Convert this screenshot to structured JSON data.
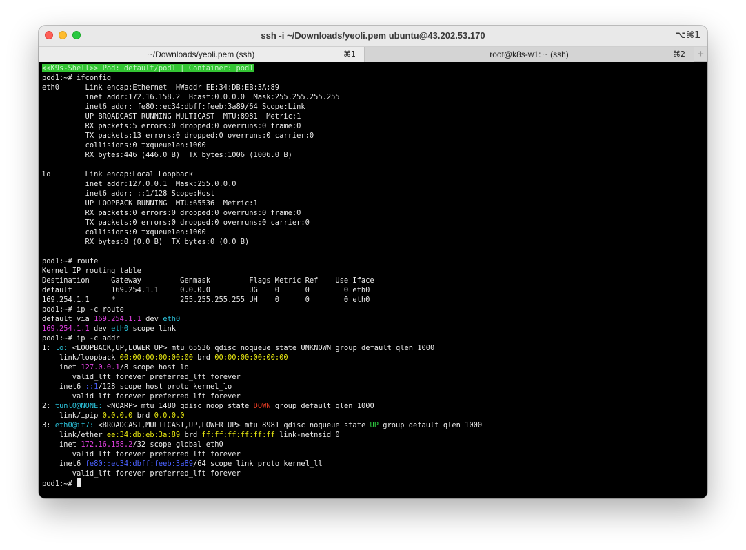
{
  "window": {
    "title": "ssh -i ~/Downloads/yeoli.pem ubuntu@43.202.53.170",
    "shortcut": "⌥⌘1"
  },
  "tabs": [
    {
      "label": "~/Downloads/yeoli.pem (ssh)",
      "shortcut": "⌘1"
    },
    {
      "label": "root@k8s-w1: ~ (ssh)",
      "shortcut": "⌘2"
    }
  ],
  "new_tab_label": "+",
  "terminal": {
    "banner": "<<K9s-Shell>> Pod: default/pod1 | Container: pod1",
    "lines": [
      "pod1:~# ifconfig",
      "eth0      Link encap:Ethernet  HWaddr EE:34:DB:EB:3A:89",
      "          inet addr:172.16.158.2  Bcast:0.0.0.0  Mask:255.255.255.255",
      "          inet6 addr: fe80::ec34:dbff:feeb:3a89/64 Scope:Link",
      "          UP BROADCAST RUNNING MULTICAST  MTU:8981  Metric:1",
      "          RX packets:5 errors:0 dropped:0 overruns:0 frame:0",
      "          TX packets:13 errors:0 dropped:0 overruns:0 carrier:0",
      "          collisions:0 txqueuelen:1000",
      "          RX bytes:446 (446.0 B)  TX bytes:1006 (1006.0 B)",
      "",
      "lo        Link encap:Local Loopback",
      "          inet addr:127.0.0.1  Mask:255.0.0.0",
      "          inet6 addr: ::1/128 Scope:Host",
      "          UP LOOPBACK RUNNING  MTU:65536  Metric:1",
      "          RX packets:0 errors:0 dropped:0 overruns:0 frame:0",
      "          TX packets:0 errors:0 dropped:0 overruns:0 carrier:0",
      "          collisions:0 txqueuelen:1000",
      "          RX bytes:0 (0.0 B)  TX bytes:0 (0.0 B)",
      "",
      "pod1:~# route",
      "Kernel IP routing table",
      "Destination     Gateway         Genmask         Flags Metric Ref    Use Iface",
      "default         169.254.1.1     0.0.0.0         UG    0      0        0 eth0",
      "169.254.1.1     *               255.255.255.255 UH    0      0        0 eth0",
      "pod1:~# ip -c route"
    ],
    "iproute": {
      "l1": [
        "default via ",
        "169.254.1.1",
        " dev ",
        "eth0"
      ],
      "l2": [
        "169.254.1.1",
        " dev ",
        "eth0",
        " scope link"
      ]
    },
    "ipaddr_cmd": "pod1:~# ip -c addr",
    "ipaddr": {
      "lo": {
        "h1": "1: ",
        "name": "lo:",
        "h2": " <LOOPBACK,UP,LOWER_UP> mtu 65536 qdisc noqueue state ",
        "state": "UNKNOWN",
        "h3": " group default qlen 1000",
        "link_pre": "    link/loopback ",
        "mac": "00:00:00:00:00:00",
        "brd_label": " brd ",
        "brd": "00:00:00:00:00:00",
        "inet_pre": "    inet ",
        "inet": "127.0.0.1",
        "inet_post": "/8 scope host lo",
        "valid1": "       valid_lft forever preferred_lft forever",
        "inet6_pre": "    inet6 ",
        "inet6": "::1",
        "inet6_post": "/128 scope host proto kernel_lo",
        "valid2": "       valid_lft forever preferred_lft forever"
      },
      "tunl": {
        "h1": "2: ",
        "name": "tunl0@NONE:",
        "h2": " <NOARP> mtu 1480 qdisc noop state ",
        "state": "DOWN",
        "h3": " group default qlen 1000",
        "link_pre": "    link/ipip ",
        "addr": "0.0.0.0",
        "brd_label": " brd ",
        "brd": "0.0.0.0"
      },
      "eth0": {
        "h1": "3: ",
        "name": "eth0@if7:",
        "h2": " <BROADCAST,MULTICAST,UP,LOWER_UP> mtu 8981 qdisc noqueue state ",
        "state": "UP",
        "h3": " group default qlen 1000",
        "link_pre": "    link/ether ",
        "mac": "ee:34:db:eb:3a:89",
        "brd_label": " brd ",
        "brd": "ff:ff:ff:ff:ff:ff",
        "link_post": " link-netnsid 0",
        "inet_pre": "    inet ",
        "inet": "172.16.158.2",
        "inet_post": "/32 scope global eth0",
        "valid1": "       valid_lft forever preferred_lft forever",
        "inet6_pre": "    inet6 ",
        "inet6": "fe80::ec34:dbff:feeb:3a89",
        "inet6_post": "/64 scope link proto kernel_ll",
        "valid2": "       valid_lft forever preferred_lft forever"
      }
    },
    "prompt": "pod1:~# "
  },
  "colors": {
    "banner_bg": "#33c533",
    "green": "#2ecc40",
    "yellow": "#e5e510",
    "magenta": "#e040e0",
    "cyan": "#2bc0d8",
    "blue": "#4a60ff",
    "red": "#e23a22"
  }
}
